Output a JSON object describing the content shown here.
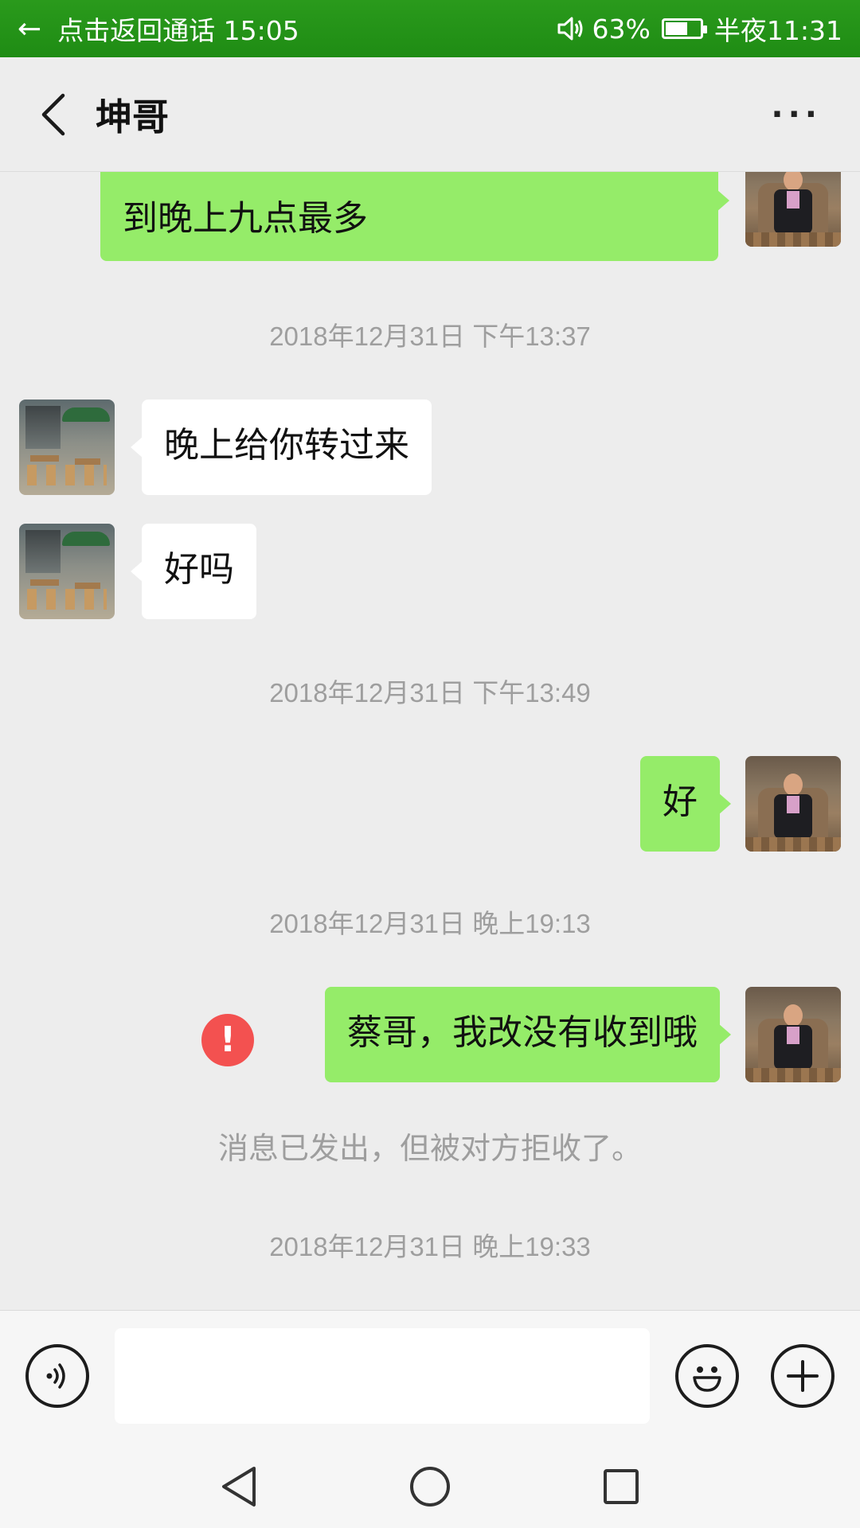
{
  "status_bar": {
    "back_label": "←",
    "call_text": "点击返回通话 15:05",
    "battery_percent": "63%",
    "time": "半夜11:31"
  },
  "header": {
    "title": "坤哥",
    "more_label": "···"
  },
  "messages": {
    "partial_top": {
      "text": "到晚上九点最多",
      "side": "me"
    },
    "ts1": "2018年12月31日 下午13:37",
    "m1": {
      "text": "晚上给你转过来",
      "side": "other"
    },
    "m2": {
      "text": "好吗",
      "side": "other"
    },
    "ts2": "2018年12月31日 下午13:49",
    "m3": {
      "text": "好",
      "side": "me"
    },
    "ts3": "2018年12月31日 晚上19:13",
    "m4": {
      "text": "蔡哥，我改没有收到哦",
      "side": "me",
      "status": "failed"
    },
    "error_mark": "!",
    "notice": "消息已发出，但被对方拒收了。",
    "ts4": "2018年12月31日 晚上19:33"
  },
  "input": {
    "value": ""
  },
  "icons": {
    "voice": "voice-icon",
    "emoji": "emoji-icon",
    "plus": "plus-icon",
    "nav_back": "nav-back-icon",
    "nav_home": "nav-home-icon",
    "nav_recent": "nav-recent-icon"
  },
  "colors": {
    "status_green": "#1f8c14",
    "bubble_green": "#95ec69",
    "bubble_white": "#ffffff",
    "error_red": "#f35150",
    "background": "#ededed"
  }
}
